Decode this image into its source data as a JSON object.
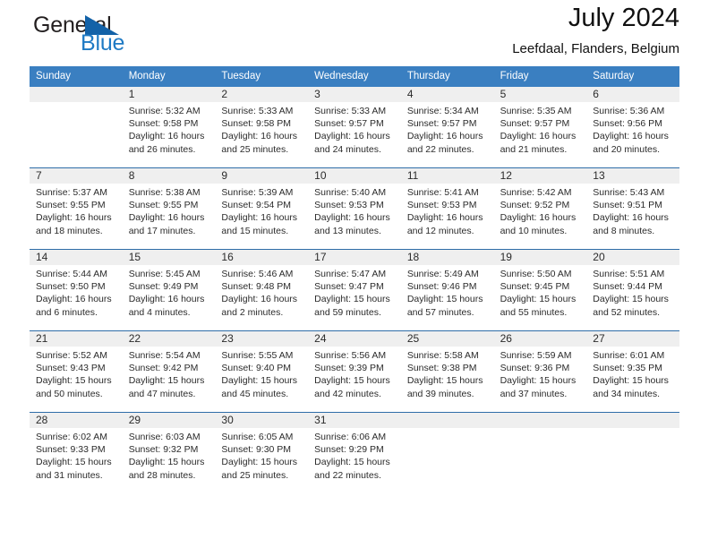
{
  "brand": {
    "name_part1": "General",
    "name_part2": "Blue",
    "logo_icon": "triangle-logo-icon"
  },
  "header": {
    "title": "July 2024",
    "subtitle": "Leefdaal, Flanders, Belgium"
  },
  "colors": {
    "header_blue": "#3a7fc1",
    "separator_blue": "#2e6da8",
    "daynum_band": "#efefef",
    "brand_blue": "#1f7ac4",
    "logo_blue": "#1362a8"
  },
  "weekdays": [
    "Sunday",
    "Monday",
    "Tuesday",
    "Wednesday",
    "Thursday",
    "Friday",
    "Saturday"
  ],
  "weeks": [
    {
      "days": [
        {
          "num": "",
          "sunrise": "",
          "sunset": "",
          "daylight_line1": "",
          "daylight_line2": ""
        },
        {
          "num": "1",
          "sunrise": "Sunrise: 5:32 AM",
          "sunset": "Sunset: 9:58 PM",
          "daylight_line1": "Daylight: 16 hours",
          "daylight_line2": "and 26 minutes."
        },
        {
          "num": "2",
          "sunrise": "Sunrise: 5:33 AM",
          "sunset": "Sunset: 9:58 PM",
          "daylight_line1": "Daylight: 16 hours",
          "daylight_line2": "and 25 minutes."
        },
        {
          "num": "3",
          "sunrise": "Sunrise: 5:33 AM",
          "sunset": "Sunset: 9:57 PM",
          "daylight_line1": "Daylight: 16 hours",
          "daylight_line2": "and 24 minutes."
        },
        {
          "num": "4",
          "sunrise": "Sunrise: 5:34 AM",
          "sunset": "Sunset: 9:57 PM",
          "daylight_line1": "Daylight: 16 hours",
          "daylight_line2": "and 22 minutes."
        },
        {
          "num": "5",
          "sunrise": "Sunrise: 5:35 AM",
          "sunset": "Sunset: 9:57 PM",
          "daylight_line1": "Daylight: 16 hours",
          "daylight_line2": "and 21 minutes."
        },
        {
          "num": "6",
          "sunrise": "Sunrise: 5:36 AM",
          "sunset": "Sunset: 9:56 PM",
          "daylight_line1": "Daylight: 16 hours",
          "daylight_line2": "and 20 minutes."
        }
      ]
    },
    {
      "days": [
        {
          "num": "7",
          "sunrise": "Sunrise: 5:37 AM",
          "sunset": "Sunset: 9:55 PM",
          "daylight_line1": "Daylight: 16 hours",
          "daylight_line2": "and 18 minutes."
        },
        {
          "num": "8",
          "sunrise": "Sunrise: 5:38 AM",
          "sunset": "Sunset: 9:55 PM",
          "daylight_line1": "Daylight: 16 hours",
          "daylight_line2": "and 17 minutes."
        },
        {
          "num": "9",
          "sunrise": "Sunrise: 5:39 AM",
          "sunset": "Sunset: 9:54 PM",
          "daylight_line1": "Daylight: 16 hours",
          "daylight_line2": "and 15 minutes."
        },
        {
          "num": "10",
          "sunrise": "Sunrise: 5:40 AM",
          "sunset": "Sunset: 9:53 PM",
          "daylight_line1": "Daylight: 16 hours",
          "daylight_line2": "and 13 minutes."
        },
        {
          "num": "11",
          "sunrise": "Sunrise: 5:41 AM",
          "sunset": "Sunset: 9:53 PM",
          "daylight_line1": "Daylight: 16 hours",
          "daylight_line2": "and 12 minutes."
        },
        {
          "num": "12",
          "sunrise": "Sunrise: 5:42 AM",
          "sunset": "Sunset: 9:52 PM",
          "daylight_line1": "Daylight: 16 hours",
          "daylight_line2": "and 10 minutes."
        },
        {
          "num": "13",
          "sunrise": "Sunrise: 5:43 AM",
          "sunset": "Sunset: 9:51 PM",
          "daylight_line1": "Daylight: 16 hours",
          "daylight_line2": "and 8 minutes."
        }
      ]
    },
    {
      "days": [
        {
          "num": "14",
          "sunrise": "Sunrise: 5:44 AM",
          "sunset": "Sunset: 9:50 PM",
          "daylight_line1": "Daylight: 16 hours",
          "daylight_line2": "and 6 minutes."
        },
        {
          "num": "15",
          "sunrise": "Sunrise: 5:45 AM",
          "sunset": "Sunset: 9:49 PM",
          "daylight_line1": "Daylight: 16 hours",
          "daylight_line2": "and 4 minutes."
        },
        {
          "num": "16",
          "sunrise": "Sunrise: 5:46 AM",
          "sunset": "Sunset: 9:48 PM",
          "daylight_line1": "Daylight: 16 hours",
          "daylight_line2": "and 2 minutes."
        },
        {
          "num": "17",
          "sunrise": "Sunrise: 5:47 AM",
          "sunset": "Sunset: 9:47 PM",
          "daylight_line1": "Daylight: 15 hours",
          "daylight_line2": "and 59 minutes."
        },
        {
          "num": "18",
          "sunrise": "Sunrise: 5:49 AM",
          "sunset": "Sunset: 9:46 PM",
          "daylight_line1": "Daylight: 15 hours",
          "daylight_line2": "and 57 minutes."
        },
        {
          "num": "19",
          "sunrise": "Sunrise: 5:50 AM",
          "sunset": "Sunset: 9:45 PM",
          "daylight_line1": "Daylight: 15 hours",
          "daylight_line2": "and 55 minutes."
        },
        {
          "num": "20",
          "sunrise": "Sunrise: 5:51 AM",
          "sunset": "Sunset: 9:44 PM",
          "daylight_line1": "Daylight: 15 hours",
          "daylight_line2": "and 52 minutes."
        }
      ]
    },
    {
      "days": [
        {
          "num": "21",
          "sunrise": "Sunrise: 5:52 AM",
          "sunset": "Sunset: 9:43 PM",
          "daylight_line1": "Daylight: 15 hours",
          "daylight_line2": "and 50 minutes."
        },
        {
          "num": "22",
          "sunrise": "Sunrise: 5:54 AM",
          "sunset": "Sunset: 9:42 PM",
          "daylight_line1": "Daylight: 15 hours",
          "daylight_line2": "and 47 minutes."
        },
        {
          "num": "23",
          "sunrise": "Sunrise: 5:55 AM",
          "sunset": "Sunset: 9:40 PM",
          "daylight_line1": "Daylight: 15 hours",
          "daylight_line2": "and 45 minutes."
        },
        {
          "num": "24",
          "sunrise": "Sunrise: 5:56 AM",
          "sunset": "Sunset: 9:39 PM",
          "daylight_line1": "Daylight: 15 hours",
          "daylight_line2": "and 42 minutes."
        },
        {
          "num": "25",
          "sunrise": "Sunrise: 5:58 AM",
          "sunset": "Sunset: 9:38 PM",
          "daylight_line1": "Daylight: 15 hours",
          "daylight_line2": "and 39 minutes."
        },
        {
          "num": "26",
          "sunrise": "Sunrise: 5:59 AM",
          "sunset": "Sunset: 9:36 PM",
          "daylight_line1": "Daylight: 15 hours",
          "daylight_line2": "and 37 minutes."
        },
        {
          "num": "27",
          "sunrise": "Sunrise: 6:01 AM",
          "sunset": "Sunset: 9:35 PM",
          "daylight_line1": "Daylight: 15 hours",
          "daylight_line2": "and 34 minutes."
        }
      ]
    },
    {
      "days": [
        {
          "num": "28",
          "sunrise": "Sunrise: 6:02 AM",
          "sunset": "Sunset: 9:33 PM",
          "daylight_line1": "Daylight: 15 hours",
          "daylight_line2": "and 31 minutes."
        },
        {
          "num": "29",
          "sunrise": "Sunrise: 6:03 AM",
          "sunset": "Sunset: 9:32 PM",
          "daylight_line1": "Daylight: 15 hours",
          "daylight_line2": "and 28 minutes."
        },
        {
          "num": "30",
          "sunrise": "Sunrise: 6:05 AM",
          "sunset": "Sunset: 9:30 PM",
          "daylight_line1": "Daylight: 15 hours",
          "daylight_line2": "and 25 minutes."
        },
        {
          "num": "31",
          "sunrise": "Sunrise: 6:06 AM",
          "sunset": "Sunset: 9:29 PM",
          "daylight_line1": "Daylight: 15 hours",
          "daylight_line2": "and 22 minutes."
        },
        {
          "num": "",
          "sunrise": "",
          "sunset": "",
          "daylight_line1": "",
          "daylight_line2": ""
        },
        {
          "num": "",
          "sunrise": "",
          "sunset": "",
          "daylight_line1": "",
          "daylight_line2": ""
        },
        {
          "num": "",
          "sunrise": "",
          "sunset": "",
          "daylight_line1": "",
          "daylight_line2": ""
        }
      ]
    }
  ]
}
